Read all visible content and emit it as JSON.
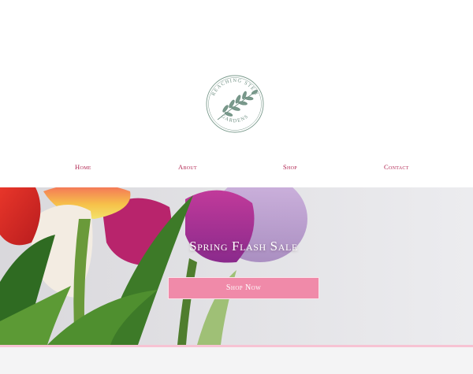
{
  "brand": {
    "logo_text_top": "REACHING STEM",
    "logo_text_bottom": "GARDENS",
    "logo_color": "#7a9a8c"
  },
  "nav": {
    "items": [
      {
        "label": "Home"
      },
      {
        "label": "About"
      },
      {
        "label": "Shop"
      },
      {
        "label": "Contact"
      }
    ],
    "color": "#b0224f"
  },
  "hero": {
    "title": "Spring Flash Sale",
    "cta_label": "Shop Now",
    "cta_color": "#f08aa9"
  },
  "colors": {
    "accent_pink": "#f08aa9",
    "divider_pink": "#f7c3d3"
  }
}
